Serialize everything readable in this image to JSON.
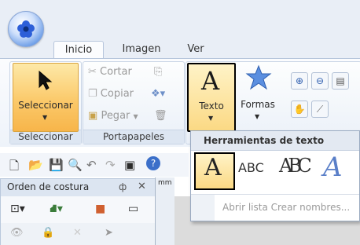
{
  "tabs": [
    "Inicio",
    "Imagen",
    "Ver"
  ],
  "groups": {
    "seleccionar": {
      "button_label": "Seleccionar",
      "group_label": "Seleccionar"
    },
    "portapapeles": {
      "cortar": "Cortar",
      "copiar": "Copiar",
      "pegar": "Pegar",
      "group_label": "Portapapeles"
    },
    "texto": {
      "label": "Texto"
    },
    "formas": {
      "label": "Formas"
    }
  },
  "panel": {
    "title": "Orden de costura",
    "pin": "ф",
    "close": "✕"
  },
  "ruler": {
    "unit": "mm"
  },
  "dropdown": {
    "header": "Herramientas de texto",
    "items": [
      "A",
      "ABC",
      "ABC",
      "A"
    ],
    "footer": "Abrir lista Crear nombres..."
  },
  "colors": {
    "accent": "#f7b54a",
    "highlight_border": "#000000",
    "ribbon_bg": "#eef3fa"
  }
}
